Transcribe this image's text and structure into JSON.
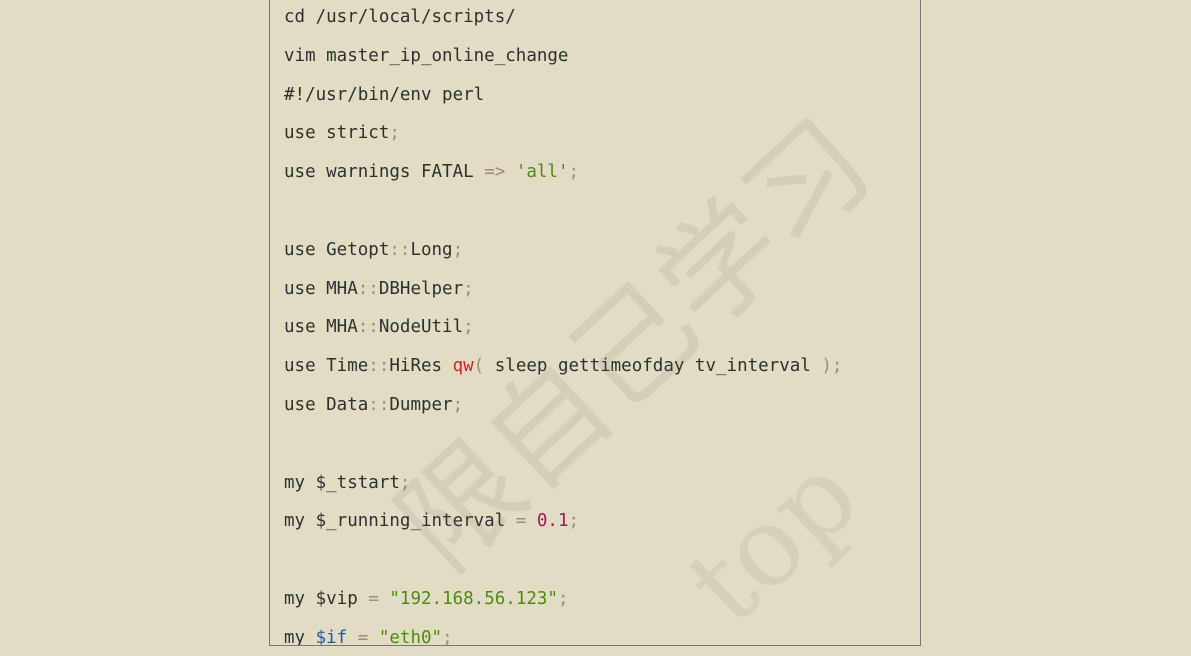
{
  "code": {
    "lines": [
      [
        {
          "t": "cd /usr/local/scripts/",
          "c": ""
        }
      ],
      [
        {
          "t": "vim master_ip_online_change",
          "c": ""
        }
      ],
      [
        {
          "t": "#!/usr/bin/env perl",
          "c": ""
        }
      ],
      [
        {
          "t": "use strict",
          "c": ""
        },
        {
          "t": ";",
          "c": "punc"
        }
      ],
      [
        {
          "t": "use warnings FATAL ",
          "c": ""
        },
        {
          "t": "=>",
          "c": "op"
        },
        {
          "t": " ",
          "c": ""
        },
        {
          "t": "'all'",
          "c": "str"
        },
        {
          "t": ";",
          "c": "punc"
        }
      ],
      [
        {
          "t": "",
          "c": ""
        }
      ],
      [
        {
          "t": "use Getopt",
          "c": ""
        },
        {
          "t": "::",
          "c": "punc"
        },
        {
          "t": "Long",
          "c": ""
        },
        {
          "t": ";",
          "c": "punc"
        }
      ],
      [
        {
          "t": "use MHA",
          "c": ""
        },
        {
          "t": "::",
          "c": "punc"
        },
        {
          "t": "DBHelper",
          "c": ""
        },
        {
          "t": ";",
          "c": "punc"
        }
      ],
      [
        {
          "t": "use MHA",
          "c": ""
        },
        {
          "t": "::",
          "c": "punc"
        },
        {
          "t": "NodeUtil",
          "c": ""
        },
        {
          "t": ";",
          "c": "punc"
        }
      ],
      [
        {
          "t": "use Time",
          "c": ""
        },
        {
          "t": "::",
          "c": "punc"
        },
        {
          "t": "HiRes ",
          "c": ""
        },
        {
          "t": "qw",
          "c": "kw"
        },
        {
          "t": "(",
          "c": "punc"
        },
        {
          "t": " sleep gettimeofday tv_interval ",
          "c": ""
        },
        {
          "t": ")",
          "c": "punc"
        },
        {
          "t": ";",
          "c": "punc"
        }
      ],
      [
        {
          "t": "use Data",
          "c": ""
        },
        {
          "t": "::",
          "c": "punc"
        },
        {
          "t": "Dumper",
          "c": ""
        },
        {
          "t": ";",
          "c": "punc"
        }
      ],
      [
        {
          "t": "",
          "c": ""
        }
      ],
      [
        {
          "t": "my $_tstart",
          "c": ""
        },
        {
          "t": ";",
          "c": "punc"
        }
      ],
      [
        {
          "t": "my $_running_interval ",
          "c": ""
        },
        {
          "t": "=",
          "c": "op"
        },
        {
          "t": " ",
          "c": ""
        },
        {
          "t": "0.1",
          "c": "num"
        },
        {
          "t": ";",
          "c": "punc"
        }
      ],
      [
        {
          "t": "",
          "c": ""
        }
      ],
      [
        {
          "t": "my $vip ",
          "c": ""
        },
        {
          "t": "=",
          "c": "op"
        },
        {
          "t": " ",
          "c": ""
        },
        {
          "t": "\"192.168.56.123\"",
          "c": "str"
        },
        {
          "t": ";",
          "c": "punc"
        }
      ],
      [
        {
          "t": "my ",
          "c": ""
        },
        {
          "t": "$if",
          "c": "var"
        },
        {
          "t": " ",
          "c": ""
        },
        {
          "t": "=",
          "c": "op"
        },
        {
          "t": " ",
          "c": ""
        },
        {
          "t": "\"eth0\"",
          "c": "str"
        },
        {
          "t": ";",
          "c": "punc"
        }
      ]
    ]
  },
  "watermark": {
    "chinese": "限自己学习",
    "latin": "top"
  }
}
